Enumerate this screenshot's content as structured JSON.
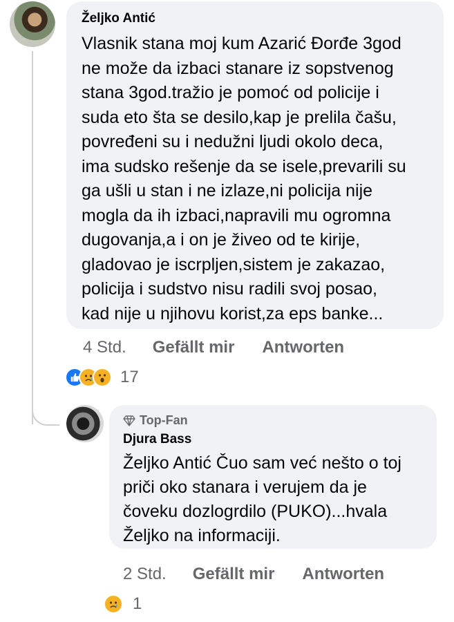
{
  "comment": {
    "author": "Željko Antić",
    "text_lines": [
      "Vlasnik stana moj kum Azarić Đorđe 3god",
      "ne može da izbaci stanare iz sopstvenog",
      "stana 3god.tražio je pomoć od policije i",
      "suda eto šta se desilo,kap je prelila čašu,",
      "povređeni  su i nedužni ljudi okolo deca,",
      "ima sudsko rešenje da se isele,prevarili su",
      "ga ušli u stan i ne izlaze,ni policija nije",
      "mogla da ih izbaci,napravili mu ogromna",
      "dugovanja,a i on je živeo od te kirije,",
      "gladovao je iscrpljen,sistem je zakazao,",
      "policija i sudstvo nisu radili svoj posao,",
      "kad nije u njihovu korist,za eps banke..."
    ],
    "time": "4 Std.",
    "like_label": "Gefällt mir",
    "reply_label": "Antworten",
    "reactions": [
      "like",
      "sad",
      "wow"
    ],
    "reaction_count": "17"
  },
  "reply": {
    "badge": "Top-Fan",
    "author": "Djura Bass",
    "text_lines": [
      "Željko Antić Čuo sam već nešto o toj",
      "priči oko stanara i verujem da je",
      "čoveku dozlogrdilo (PUKO)...hvala",
      "Željko na informaciji."
    ],
    "time": "2 Std.",
    "like_label": "Gefällt mir",
    "reply_label": "Antworten",
    "reactions": [
      "sad"
    ],
    "reaction_count": "1"
  },
  "colors": {
    "bubble": "#f0f2f5",
    "meta": "#65676b",
    "like_blue": "#1877f2",
    "emoji_yellow": "#f7b125"
  }
}
